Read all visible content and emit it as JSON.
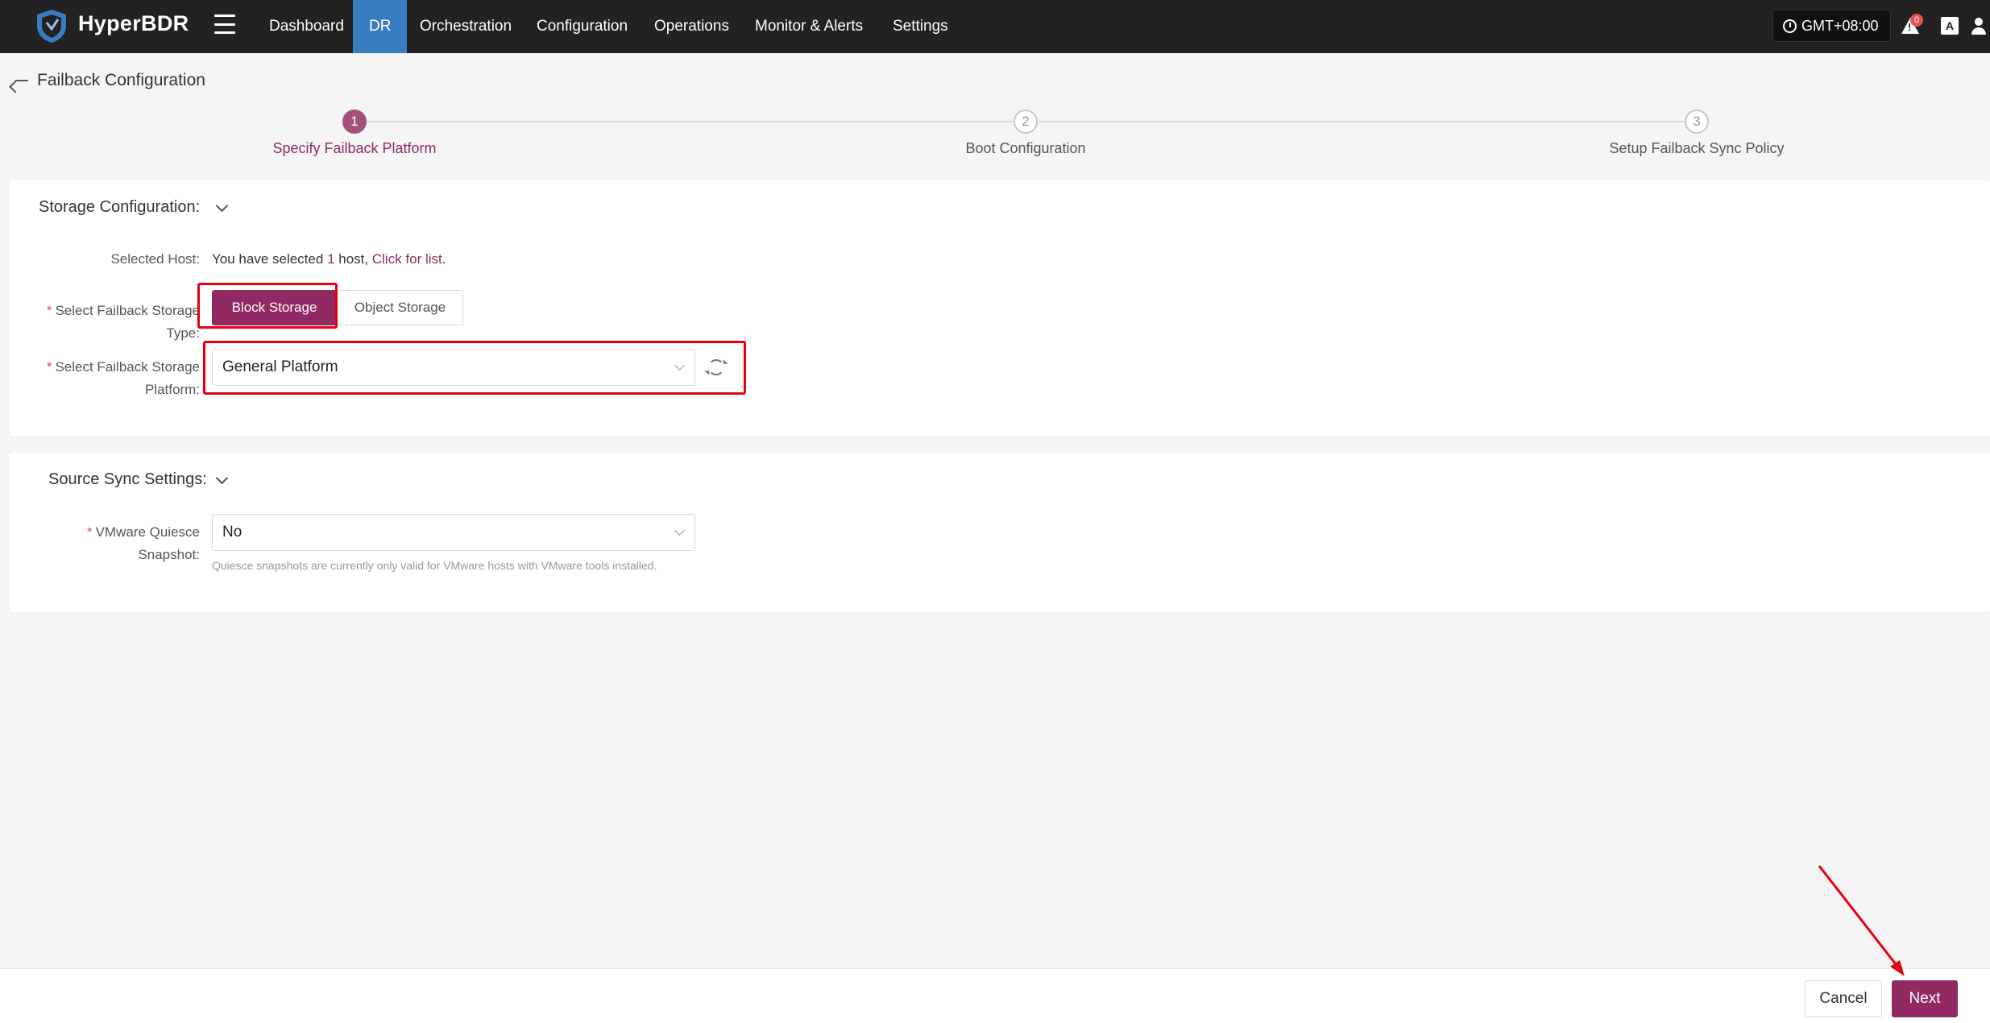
{
  "app": {
    "brand": "HyperBDR",
    "nav": [
      {
        "label": "Dashboard",
        "active": false
      },
      {
        "label": "DR",
        "active": true
      },
      {
        "label": "Orchestration",
        "active": false
      },
      {
        "label": "Configuration",
        "active": false
      },
      {
        "label": "Operations",
        "active": false
      },
      {
        "label": "Monitor & Alerts",
        "active": false
      },
      {
        "label": "Settings",
        "active": false
      }
    ],
    "timezone": "GMT+08:00",
    "alert_count": "0",
    "lang_icon": "A"
  },
  "page": {
    "title": "Failback Configuration"
  },
  "steps": [
    {
      "number": "1",
      "label": "Specify Failback Platform",
      "active": true
    },
    {
      "number": "2",
      "label": "Boot Configuration",
      "active": false
    },
    {
      "number": "3",
      "label": "Setup Failback Sync Policy",
      "active": false
    }
  ],
  "storage": {
    "title": "Storage Configuration:",
    "selected_host_label": "Selected Host:",
    "selected_host_prefix": "You have selected",
    "selected_host_count": "1",
    "selected_host_suffix": "host,",
    "selected_host_link": "Click for list",
    "selected_host_end": ".",
    "storage_type_label_line1": "Select Failback Storage",
    "storage_type_label_line2": "Type:",
    "storage_type_options": [
      "Block Storage",
      "Object Storage"
    ],
    "storage_type_selected": "Block Storage",
    "platform_label_line1": "Select Failback Storage",
    "platform_label_line2": "Platform:",
    "platform_value": "General Platform"
  },
  "source_sync": {
    "title": "Source Sync Settings:",
    "quiesce_label_line1": "VMware Quiesce",
    "quiesce_label_line2": "Snapshot:",
    "quiesce_value": "No",
    "quiesce_hint": "Quiesce snapshots are currently only valid for VMware hosts with VMware tools installed."
  },
  "footer": {
    "cancel_label": "Cancel",
    "next_label": "Next"
  },
  "colors": {
    "primary": "#912a62",
    "nav_bg": "#222222",
    "nav_active": "#3a7cc2",
    "annotation_red": "#e60012"
  }
}
